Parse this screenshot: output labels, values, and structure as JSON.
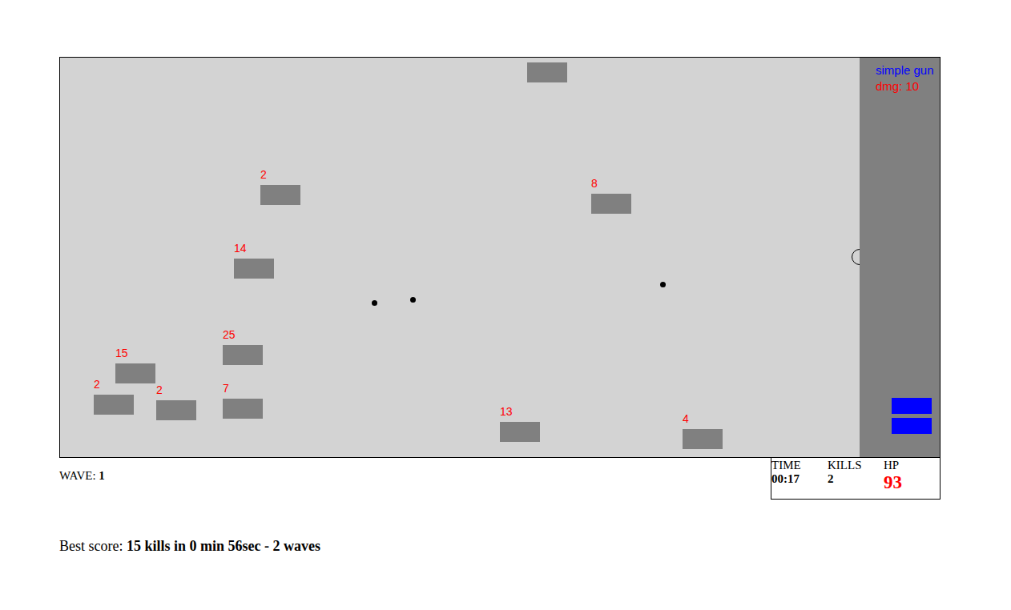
{
  "weapon": {
    "name": "simple gun",
    "damage": "dmg: 10"
  },
  "enemies": [
    {
      "hp": ""
    },
    {
      "hp": "2"
    },
    {
      "hp": "8"
    },
    {
      "hp": "14"
    },
    {
      "hp": "25"
    },
    {
      "hp": "15"
    },
    {
      "hp": "2"
    },
    {
      "hp": "2"
    },
    {
      "hp": "7"
    },
    {
      "hp": "13"
    },
    {
      "hp": "4"
    }
  ],
  "wave": {
    "label": "WAVE:",
    "value": "1"
  },
  "stats": [
    {
      "label": "TIME",
      "value": "00:17",
      "kind": "plain"
    },
    {
      "label": "KILLS",
      "value": "2",
      "kind": "plain"
    },
    {
      "label": "HP",
      "value": "93",
      "kind": "health"
    }
  ],
  "best_score": {
    "label": "Best score:",
    "value": "15 kills in 0 min 56sec - 2 waves"
  }
}
